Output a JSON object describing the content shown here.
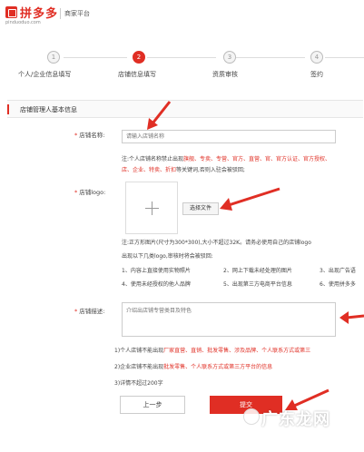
{
  "header": {
    "logo": "拼多多",
    "domain": "pinduoduo.com",
    "merchant_platform": "商家平台"
  },
  "steps": [
    {
      "num": "1",
      "label": "个人/企业信息填写",
      "active": false
    },
    {
      "num": "2",
      "label": "店铺信息填写",
      "active": true
    },
    {
      "num": "3",
      "label": "资质审核",
      "active": false
    },
    {
      "num": "4",
      "label": "签约",
      "active": false
    }
  ],
  "section": {
    "title": "店铺管理人基本信息"
  },
  "shop_name": {
    "label": "店铺名称:",
    "placeholder": "请输入店铺名称",
    "note1_prefix": "注:个人店铺名称禁止出现",
    "note1_red": "旗舰、专卖、专营、官方、直营、官、官方认证、官方授权、",
    "note2_red": "店、企业、特卖、折扣",
    "note2_suffix": "等关键词,否则入驻会被驳回;"
  },
  "shop_logo": {
    "label": "店铺logo:",
    "choose_button": "选择文件",
    "note1": "注:正方形图片(尺寸为300*300),大小不超过32K。请务必使用自己的店铺logo",
    "note2": "出现以下几类logo,审核时将会被驳回:",
    "rules": [
      "1、内容上直接使用实物照片",
      "2、网上下载未经处理的图片",
      "3、出现广告语",
      "4、使用未经授权的他人品牌",
      "5、出现第三方电商平台信息",
      "6、使用拼多多"
    ]
  },
  "shop_desc": {
    "label": "店铺描述:",
    "placeholder": "介绍出店铺专营类目及特色",
    "rule1_prefix": "1)个人店铺不能出现",
    "rule1_red": "厂家直营、直销、批发零售、涉及品牌、个人联系方式或第三",
    "rule2_prefix": "2)企业店铺不能出现",
    "rule2_red": "批发零售、个人联系方式或第三方平台的信息",
    "rule3": "3)详情不超过200字"
  },
  "buttons": {
    "prev": "上一步",
    "next": "提交"
  },
  "watermark": "广东龙网"
}
